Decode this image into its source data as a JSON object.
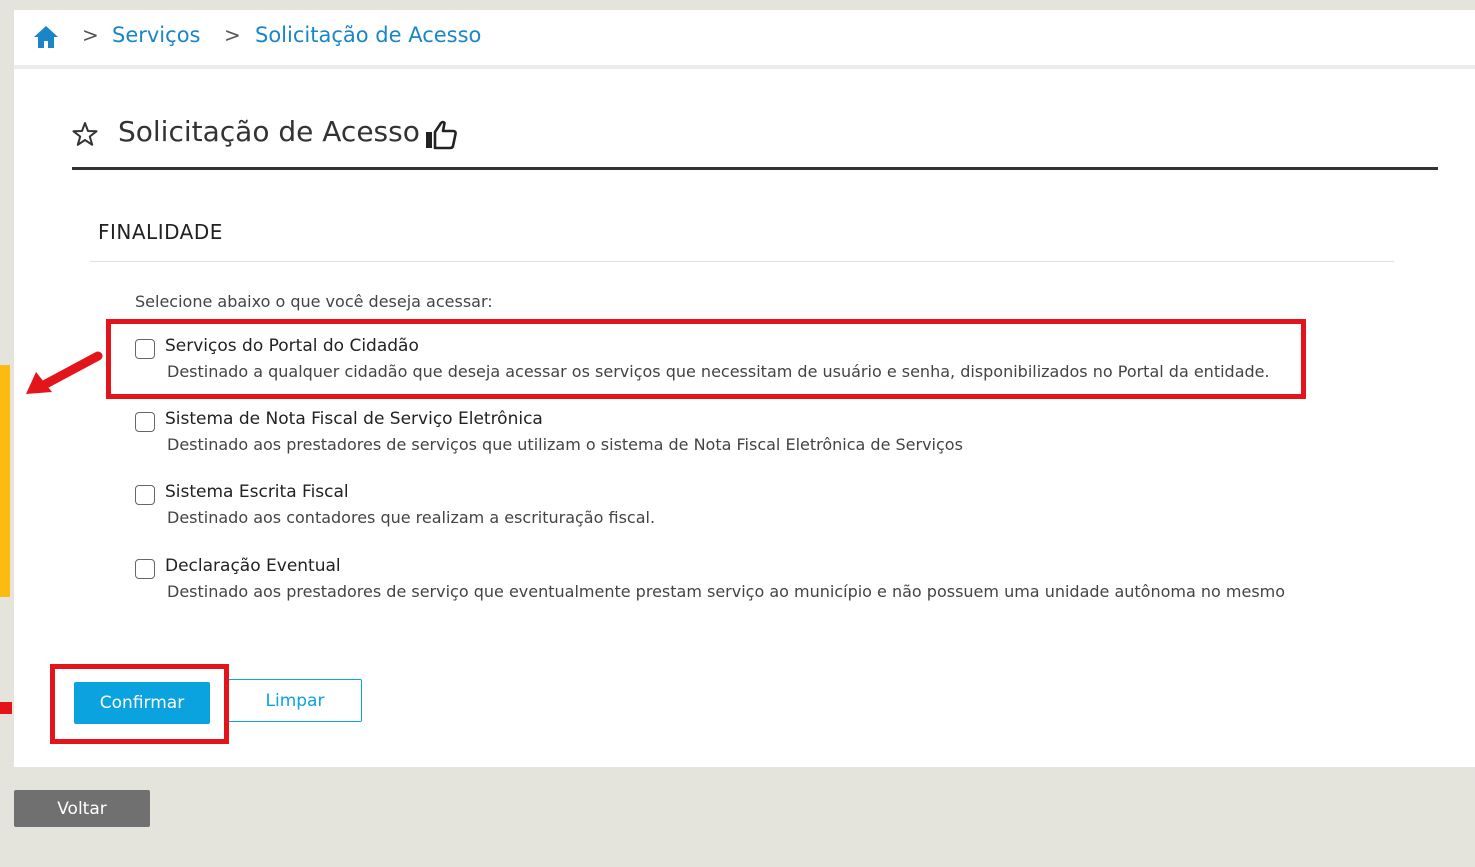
{
  "breadcrumb": {
    "home_icon": "home-icon",
    "separator": ">",
    "items": [
      "Serviços",
      "Solicitação de Acesso"
    ]
  },
  "header": {
    "title": "Solicitação de Acesso",
    "favorite_icon": "star-icon",
    "like_icon": "thumbs-up-icon"
  },
  "section": {
    "title": "FINALIDADE",
    "intro": "Selecione abaixo o que você deseja acessar:"
  },
  "options": [
    {
      "title": "Serviços do Portal do Cidadão",
      "description": "Destinado a qualquer cidadão que deseja acessar os serviços que necessitam de usuário e senha, disponibilizados no Portal da entidade.",
      "checked": false
    },
    {
      "title": "Sistema de Nota Fiscal de Serviço Eletrônica",
      "description": "Destinado aos prestadores de serviços que utilizam o sistema de Nota Fiscal Eletrônica de Serviços",
      "checked": false
    },
    {
      "title": "Sistema Escrita Fiscal",
      "description": "Destinado aos contadores que realizam a escrituração fiscal.",
      "checked": false
    },
    {
      "title": "Declaração Eventual",
      "description": "Destinado aos prestadores de serviço que eventualmente prestam serviço ao município e não possuem uma unidade autônoma no mesmo",
      "checked": false
    }
  ],
  "actions": {
    "confirm_label": "Confirmar",
    "clear_label": "Limpar",
    "back_label": "Voltar"
  },
  "colors": {
    "link": "#1a86c8",
    "primary": "#0aa3e0",
    "highlight": "#e3151b",
    "back_button": "#707070"
  }
}
